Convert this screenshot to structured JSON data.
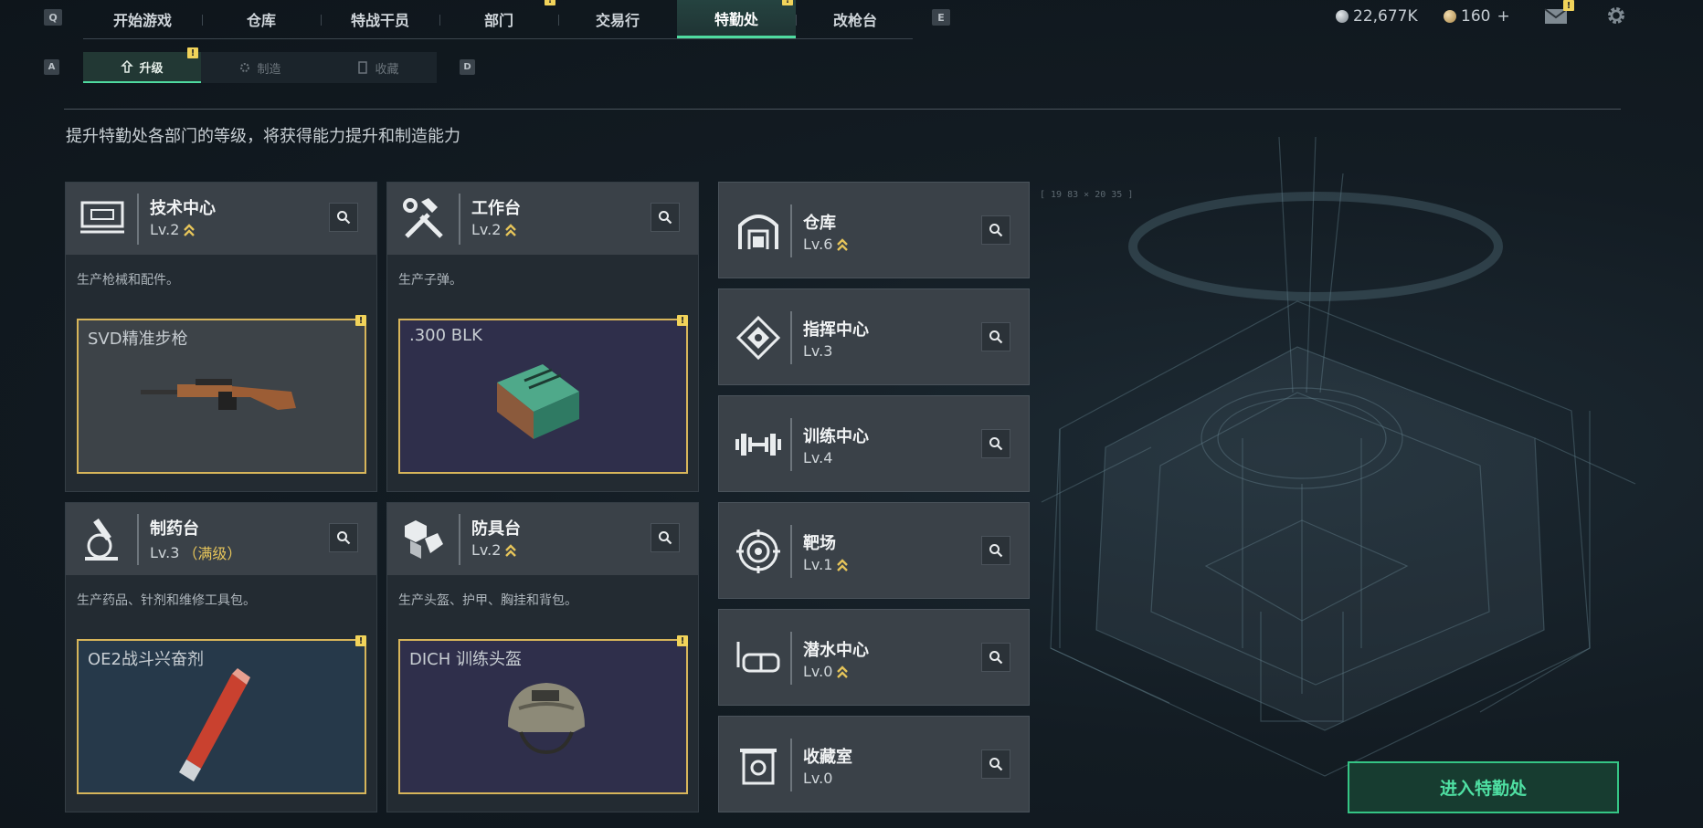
{
  "nav": {
    "key_left": "Q",
    "key_right": "E",
    "tabs": [
      {
        "label": "开始游戏",
        "active": false,
        "badge": false
      },
      {
        "label": "仓库",
        "active": false,
        "badge": false
      },
      {
        "label": "特战干员",
        "active": false,
        "badge": false
      },
      {
        "label": "部门",
        "active": false,
        "badge": true
      },
      {
        "label": "交易行",
        "active": false,
        "badge": false
      },
      {
        "label": "特勤处",
        "active": true,
        "badge": true
      },
      {
        "label": "改枪台",
        "active": false,
        "badge": false
      }
    ],
    "badge_mark": "!",
    "accent_color": "#4fdba0"
  },
  "currency": {
    "silver": "22,677K",
    "gold": "160",
    "gold_add": "+"
  },
  "sub_nav": {
    "key_left": "A",
    "key_right": "D",
    "tabs": [
      {
        "label": "升级",
        "icon": "upgrade-icon",
        "active": true
      },
      {
        "label": "制造",
        "icon": "craft-icon",
        "active": false
      },
      {
        "label": "收藏",
        "icon": "collection-icon",
        "active": false
      }
    ]
  },
  "page": {
    "subtitle": "提升特勤处各部门的等级，将获得能力提升和制造能力",
    "coords_label": "[ 19 83 × 20 35 ]",
    "enter_button": "进入特勤处"
  },
  "workshops": [
    {
      "title": "技术中心",
      "level": "Lv.2",
      "upgradable": true,
      "desc": "生产枪械和配件。",
      "craft": "SVD精准步枪",
      "icon": "tech-center-icon",
      "box_color": "#3d4348"
    },
    {
      "title": "工作台",
      "level": "Lv.2",
      "upgradable": true,
      "desc": "生产子弹。",
      "craft": ".300 BLK",
      "icon": "workbench-icon",
      "box_color": "#2f2f4b"
    },
    {
      "title": "制药台",
      "level": "Lv.3",
      "upgradable": false,
      "maxed_label": "（满级）",
      "desc": "生产药品、针剂和维修工具包。",
      "craft": "OE2战斗兴奋剂",
      "icon": "pharmacy-icon",
      "box_color": "#26394a"
    },
    {
      "title": "防具台",
      "level": "Lv.2",
      "upgradable": true,
      "desc": "生产头盔、护甲、胸挂和背包。",
      "craft": "DICH 训练头盔",
      "icon": "armor-bench-icon",
      "box_color": "#2f2f4b"
    }
  ],
  "facilities": [
    {
      "title": "仓库",
      "level": "Lv.6",
      "upgradable": true,
      "icon": "warehouse-icon"
    },
    {
      "title": "指挥中心",
      "level": "Lv.3",
      "upgradable": false,
      "icon": "command-center-icon"
    },
    {
      "title": "训练中心",
      "level": "Lv.4",
      "upgradable": false,
      "icon": "training-center-icon"
    },
    {
      "title": "靶场",
      "level": "Lv.1",
      "upgradable": true,
      "icon": "target-range-icon"
    },
    {
      "title": "潜水中心",
      "level": "Lv.0",
      "upgradable": true,
      "icon": "diving-center-icon"
    },
    {
      "title": "收藏室",
      "level": "Lv.0",
      "upgradable": false,
      "icon": "collection-room-icon"
    }
  ]
}
